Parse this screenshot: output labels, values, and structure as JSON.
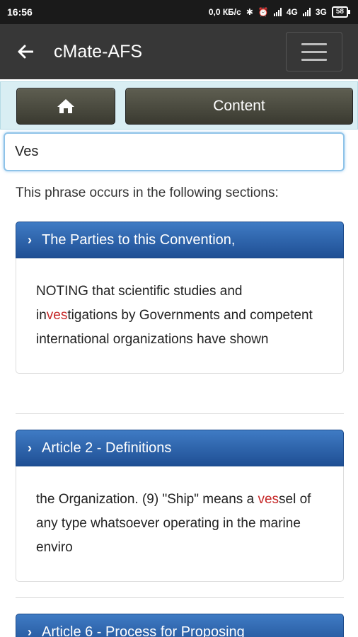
{
  "status_bar": {
    "time": "16:56",
    "network_speed": "0,0 КБ/с",
    "network_4g": "4G",
    "network_3g": "3G",
    "battery": "58"
  },
  "app_bar": {
    "title": "cMate-AFS",
    "back_icon": "arrow-left-icon",
    "menu_icon": "hamburger-icon"
  },
  "nav": {
    "home_icon": "home-icon",
    "content_label": "Content"
  },
  "search": {
    "value": "Ves"
  },
  "intro_text": "This phrase occurs in the following sections:",
  "results": [
    {
      "title": "The Parties to this Convention,",
      "snippet_before": "NOTING that scientific studies and in",
      "match": "ves",
      "snippet_after": "tigations by Governments and competent international organizations have shown"
    },
    {
      "title": "Article 2 - Definitions",
      "snippet_before": "the Organization. (9) \"Ship\" means a ",
      "match": "ves",
      "snippet_after": "sel of any type whatsoever operating in the marine enviro"
    },
    {
      "title": "Article 6 - Process for Proposing"
    }
  ],
  "colors": {
    "header_blue": "#2b5fa8",
    "highlight": "#c62828",
    "app_bar": "#373737"
  }
}
